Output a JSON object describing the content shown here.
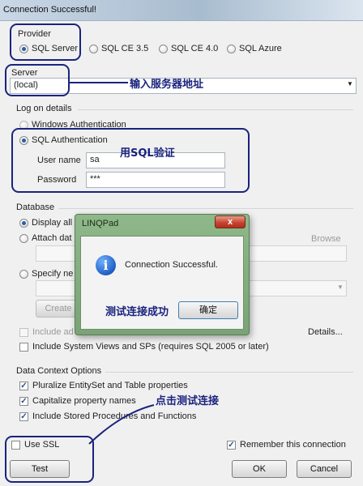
{
  "window": {
    "title": "Connection Successful!"
  },
  "provider": {
    "label": "Provider",
    "options": [
      "SQL Server",
      "SQL CE 3.5",
      "SQL CE 4.0",
      "SQL Azure"
    ],
    "selected": "SQL Server"
  },
  "server": {
    "label": "Server",
    "value": "(local)"
  },
  "logon": {
    "label": "Log on details",
    "windows_auth": "Windows Authentication",
    "sql_auth": "SQL Authentication",
    "username_label": "User name",
    "username_value": "sa",
    "password_label": "Password",
    "password_value": "***"
  },
  "database": {
    "label": "Database",
    "display_all": "Display all",
    "attach": "Attach dat",
    "browse": "Browse",
    "specify": "Specify ne",
    "create": "Create",
    "include_ad": "Include ad",
    "details": "Details...",
    "include_system": "Include System Views and SPs (requires SQL 2005 or later)"
  },
  "context": {
    "label": "Data Context Options",
    "options": [
      "Pluralize EntitySet and Table properties",
      "Capitalize property names",
      "Include Stored Procedures and Functions"
    ]
  },
  "footer": {
    "use_ssl": "Use SSL",
    "remember": "Remember this connection",
    "test": "Test",
    "ok": "OK",
    "cancel": "Cancel"
  },
  "popup": {
    "title": "LINQPad",
    "message": "Connection Successful.",
    "ok_button": "确定",
    "close": "x"
  },
  "annotations": {
    "server": "输入服务器地址",
    "sql_auth": "用SQL验证",
    "test_success": "测试连接成功",
    "click_test": "点击测试连接"
  }
}
